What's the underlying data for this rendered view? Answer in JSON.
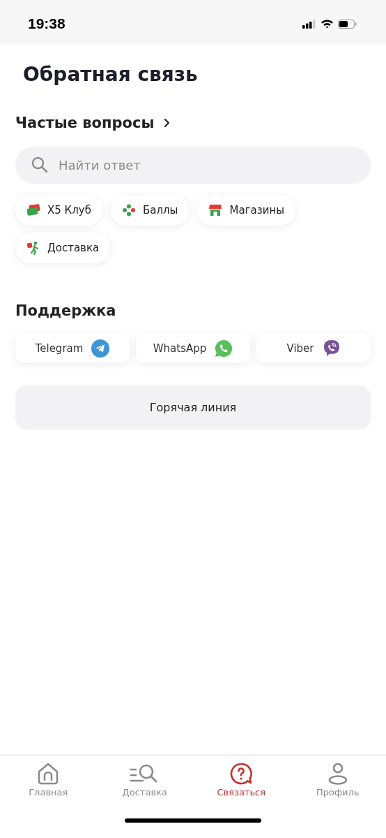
{
  "status_bar": {
    "time": "19:38"
  },
  "title": "Обратная связь",
  "faq": {
    "heading": "Частые вопросы",
    "search": {
      "placeholder": "Найти ответ"
    },
    "chips": [
      {
        "label": "X5 Клуб",
        "kind": "card"
      },
      {
        "label": "Баллы",
        "kind": "dots"
      },
      {
        "label": "Магазины",
        "kind": "store"
      },
      {
        "label": "Доставка",
        "kind": "courier"
      }
    ]
  },
  "support": {
    "heading": "Поддержка",
    "messengers": [
      {
        "label": "Telegram",
        "kind": "telegram"
      },
      {
        "label": "WhatsApp",
        "kind": "whatsapp"
      },
      {
        "label": "Viber",
        "kind": "viber"
      }
    ],
    "hotline": "Горячая линия"
  },
  "tab_bar": [
    {
      "label": "Главная",
      "kind": "home",
      "selected": false
    },
    {
      "label": "Доставка",
      "kind": "delivery",
      "selected": false
    },
    {
      "label": "Связаться",
      "kind": "contact",
      "selected": true
    },
    {
      "label": "Профиль",
      "kind": "profile",
      "selected": false
    }
  ]
}
